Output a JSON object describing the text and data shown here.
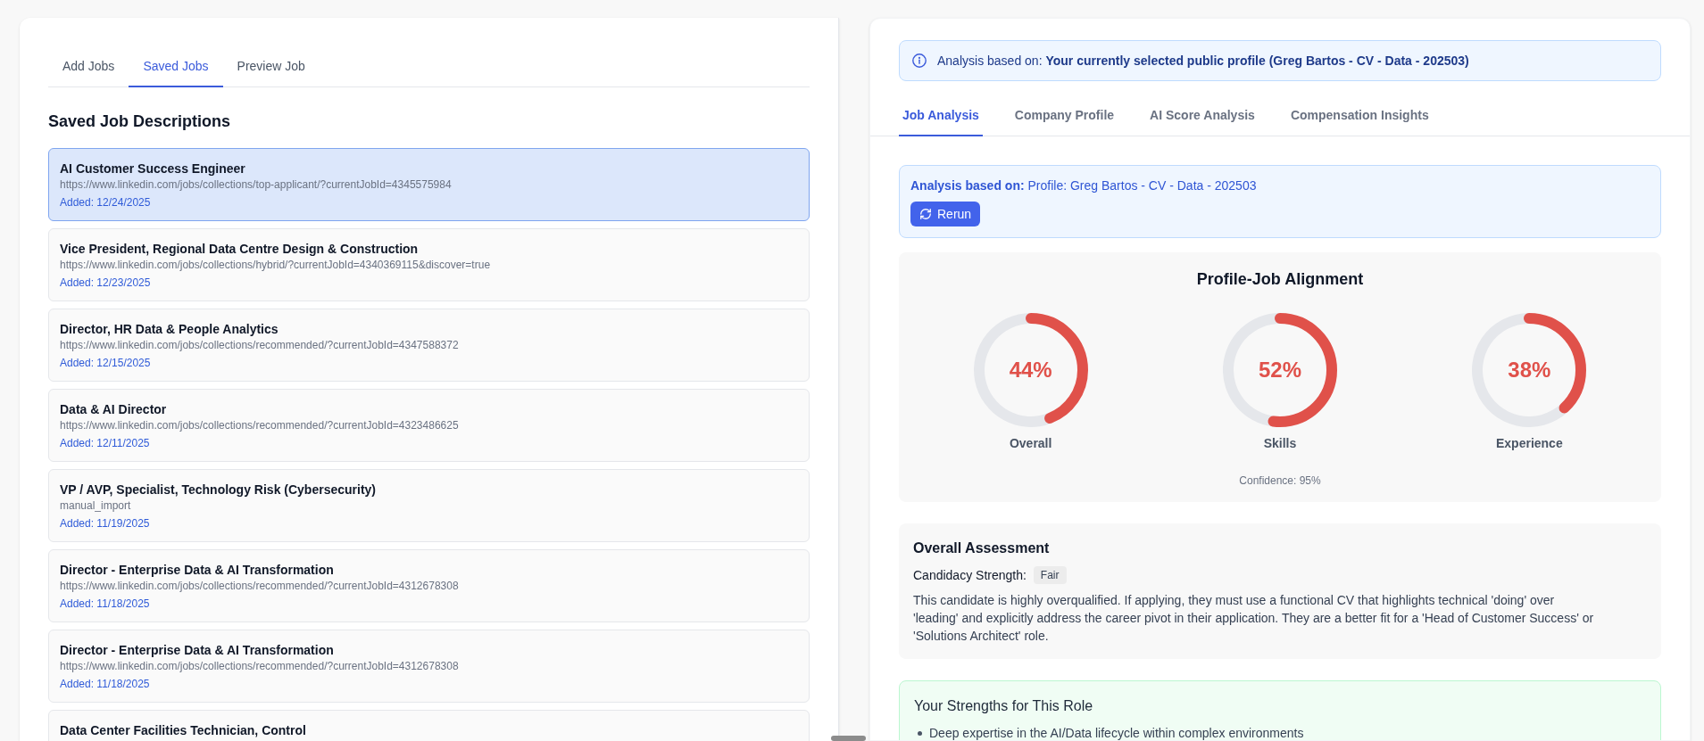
{
  "left_panel": {
    "tabs": [
      {
        "label": "Add Jobs",
        "selected": false
      },
      {
        "label": "Saved Jobs",
        "selected": true
      },
      {
        "label": "Preview Job",
        "selected": false
      }
    ],
    "heading": "Saved Job Descriptions",
    "jobs": [
      {
        "title": "AI Customer Success Engineer",
        "source": "https://www.linkedin.com/jobs/collections/top-applicant/?currentJobId=4345575984",
        "added": "Added: 12/24/2025",
        "selected": true
      },
      {
        "title": "Vice President, Regional Data Centre Design & Construction",
        "source": "https://www.linkedin.com/jobs/collections/hybrid/?currentJobId=4340369115&discover=true",
        "added": "Added: 12/23/2025",
        "selected": false
      },
      {
        "title": "Director, HR Data & People Analytics",
        "source": "https://www.linkedin.com/jobs/collections/recommended/?currentJobId=4347588372",
        "added": "Added: 12/15/2025",
        "selected": false
      },
      {
        "title": "Data & AI Director",
        "source": "https://www.linkedin.com/jobs/collections/recommended/?currentJobId=4323486625",
        "added": "Added: 12/11/2025",
        "selected": false
      },
      {
        "title": "VP / AVP, Specialist, Technology Risk (Cybersecurity)",
        "source": "manual_import",
        "added": "Added: 11/19/2025",
        "selected": false
      },
      {
        "title": "Director - Enterprise Data & AI Transformation",
        "source": "https://www.linkedin.com/jobs/collections/recommended/?currentJobId=4312678308",
        "added": "Added: 11/18/2025",
        "selected": false
      },
      {
        "title": "Director - Enterprise Data & AI Transformation",
        "source": "https://www.linkedin.com/jobs/collections/recommended/?currentJobId=4312678308",
        "added": "Added: 11/18/2025",
        "selected": false
      },
      {
        "title": "Data Center Facilities Technician, Control",
        "selected": false
      }
    ]
  },
  "right_panel": {
    "profile_notice": "Analysis based on: **Your currently selected public profile (Greg Bartos - CV - Data - 202503)**",
    "tabs": [
      {
        "label": "Job Analysis",
        "selected": true
      },
      {
        "label": "Company Profile",
        "selected": false
      },
      {
        "label": "AI Score Analysis",
        "selected": false
      },
      {
        "label": "Compensation Insights",
        "selected": false
      }
    ],
    "analysis_source": {
      "text": "**Analysis based on:** Profile: Greg Bartos - CV - Data - 202503",
      "button": "Rerun"
    },
    "alignment": {
      "title": "Profile-Job Alignment",
      "gauges": [
        {
          "label": "Overall",
          "value": "44%",
          "level": 0.44
        },
        {
          "label": "Skills",
          "value": "52%",
          "level": 0.52
        },
        {
          "label": "Experience",
          "value": "38%",
          "level": 0.38
        }
      ],
      "confidence": "Confidence: 95%"
    },
    "assessment": {
      "title": "Overall Assessment",
      "strength_label": "Candidacy Strength:",
      "strength": "Fair",
      "summary": "This candidate is highly overqualified. If applying, they must use a functional CV that highlights technical 'doing' over 'leading' and explicitly address the career pivot in their application. They are a better fit for a 'Head of Customer Success' or 'Solutions Architect' role."
    },
    "strengths": {
      "title": "Your Strengths for This Role",
      "items": [
        "Deep expertise in the AI/Data lifecycle within complex environments"
      ]
    }
  }
}
